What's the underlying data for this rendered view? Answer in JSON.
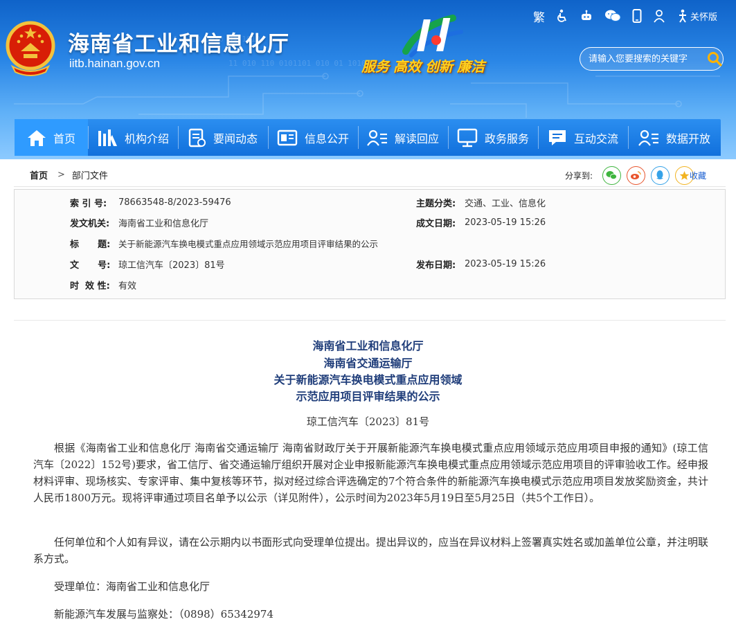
{
  "header": {
    "site_name": "海南省工业和信息化厅",
    "site_domain": "iitb.hainan.gov.cn",
    "slogans": [
      "服务",
      "高效",
      "创新",
      "廉洁"
    ],
    "toolbar": {
      "traditional": "繁",
      "elder_mode": "关怀版"
    },
    "search": {
      "placeholder": "请输入您要搜索的关键字"
    }
  },
  "nav": {
    "items": [
      {
        "label": "首页",
        "icon": "home-icon"
      },
      {
        "label": "机构介绍",
        "icon": "building-icon"
      },
      {
        "label": "要闻动态",
        "icon": "news-icon"
      },
      {
        "label": "信息公开",
        "icon": "info-icon"
      },
      {
        "label": "解读回应",
        "icon": "user-list-icon"
      },
      {
        "label": "政务服务",
        "icon": "monitor-icon"
      },
      {
        "label": "互动交流",
        "icon": "chat-icon"
      },
      {
        "label": "数据开放",
        "icon": "data-user-icon"
      }
    ]
  },
  "breadcrumb": {
    "home": "首页",
    "separator": ">",
    "current": "部门文件"
  },
  "share": {
    "label": "分享到:",
    "favorite": "收藏"
  },
  "meta": {
    "index_label": "索  引 号:",
    "index_value": "78663548-8/2023-59476",
    "topic_label": "主题分类:",
    "topic_value": "交通、工业、信息化",
    "issuer_label": "发文机关:",
    "issuer_value": "海南省工业和信息化厅",
    "date_label": "成文日期:",
    "date_value": "2023-05-19 15:26",
    "title_label": "标      题:",
    "title_value": "关于新能源汽车换电模式重点应用领域示范应用项目评审结果的公示",
    "docno_label": "文      号:",
    "docno_value": "琼工信汽车〔2023〕81号",
    "publish_label": "发布日期:",
    "publish_value": "2023-05-19 15:26",
    "validity_label": "时  效 性:",
    "validity_value": "有效"
  },
  "article": {
    "title_lines": [
      "海南省工业和信息化厅",
      "海南省交通运输厅",
      "关于新能源汽车换电模式重点应用领域",
      "示范应用项目评审结果的公示"
    ],
    "doc_number": "琼工信汽车〔2023〕81号",
    "paragraphs": [
      "根据《海南省工业和信息化厅 海南省交通运输厅 海南省财政厅关于开展新能源汽车换电模式重点应用领域示范应用项目申报的通知》(琼工信汽车〔2022〕152号)要求，省工信厅、省交通运输厅组织开展对企业申报新能源汽车换电模式重点应用领域示范应用项目的评审验收工作。经申报材料评审、现场核实、专家评审、集中复核等环节，拟对经过综合评选确定的7个符合条件的新能源汽车换电模式示范应用项目发放奖励资金，共计人民币1800万元。现将评审通过项目名单予以公示（详见附件），公示时间为2023年5月19日至5月25日（共5个工作日）。",
      "任何单位和个人如有异议，请在公示期内以书面形式向受理单位提出。提出异议的，应当在异议材料上签署真实姓名或加盖单位公章，并注明联系方式。",
      "受理单位：海南省工业和信息化厅",
      "新能源汽车发展与监察处：（0898）65342974"
    ]
  }
}
